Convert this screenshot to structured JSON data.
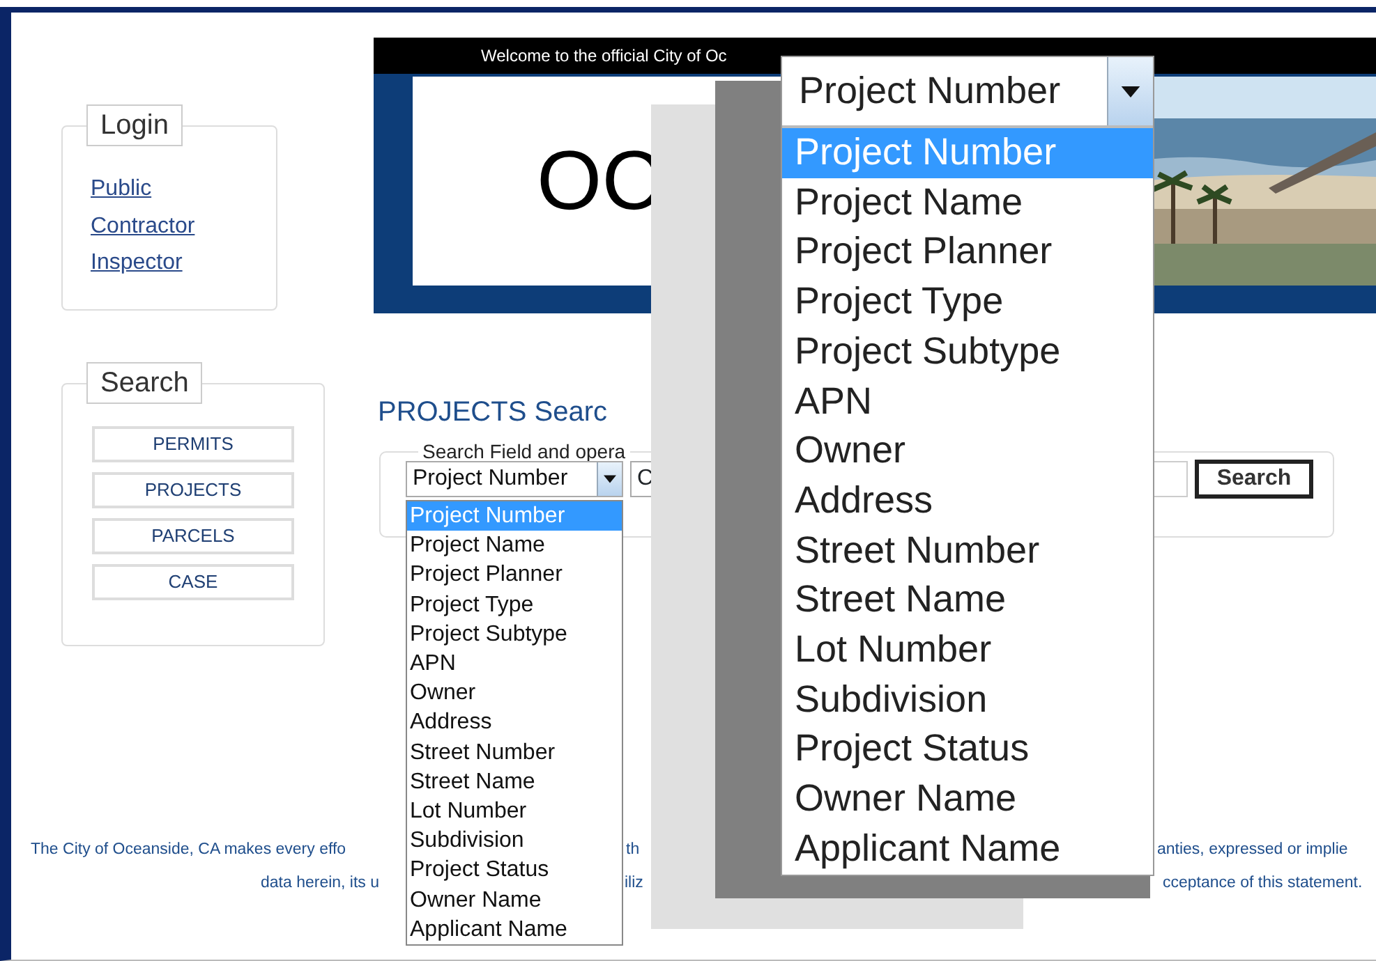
{
  "login": {
    "title": "Login",
    "links": [
      "Public",
      "Contractor",
      "Inspector"
    ]
  },
  "search_menu": {
    "title": "Search",
    "buttons": [
      "PERMITS",
      "PROJECTS",
      "PARCELS",
      "CASE"
    ]
  },
  "banner": {
    "welcome": "Welcome to the official City of Oc",
    "logo_text": "OC"
  },
  "projects_search": {
    "heading": "PROJECTS Searc",
    "legend": "Search Field and opera",
    "field_select": {
      "value": "Project Number",
      "expanded": true
    },
    "operator_select": {
      "value": "C"
    },
    "search_button": "Search",
    "options": [
      {
        "label": "Project Number",
        "selected": true
      },
      {
        "label": "Project Name",
        "selected": false
      },
      {
        "label": "Project Planner",
        "selected": false
      },
      {
        "label": "Project Type",
        "selected": false
      },
      {
        "label": "Project Subtype",
        "selected": false
      },
      {
        "label": "APN",
        "selected": false
      },
      {
        "label": "Owner",
        "selected": false
      },
      {
        "label": "Address",
        "selected": false
      },
      {
        "label": "Street Number",
        "selected": false
      },
      {
        "label": "Street Name",
        "selected": false
      },
      {
        "label": "Lot Number",
        "selected": false
      },
      {
        "label": "Subdivision",
        "selected": false
      },
      {
        "label": "Project Status",
        "selected": false
      },
      {
        "label": "Owner Name",
        "selected": false
      },
      {
        "label": "Applicant Name",
        "selected": false
      }
    ]
  },
  "zoom_callout": {
    "select_value": "Project Number",
    "expanded": true,
    "options": [
      {
        "label": "Project Number",
        "selected": true
      },
      {
        "label": "Project Name",
        "selected": false
      },
      {
        "label": "Project Planner",
        "selected": false
      },
      {
        "label": "Project Type",
        "selected": false
      },
      {
        "label": "Project Subtype",
        "selected": false
      },
      {
        "label": "APN",
        "selected": false
      },
      {
        "label": "Owner",
        "selected": false
      },
      {
        "label": "Address",
        "selected": false
      },
      {
        "label": "Street Number",
        "selected": false
      },
      {
        "label": "Street Name",
        "selected": false
      },
      {
        "label": "Lot Number",
        "selected": false
      },
      {
        "label": "Subdivision",
        "selected": false
      },
      {
        "label": "Project Status",
        "selected": false
      },
      {
        "label": "Owner Name",
        "selected": false
      },
      {
        "label": "Applicant Name",
        "selected": false
      }
    ]
  },
  "footer": {
    "line_1": [
      "The City of Oceanside, CA makes every effo",
      "th",
      "anties, expressed or implie"
    ],
    "line_2": [
      "data herein, its u",
      "iliz",
      "cceptance of this statement."
    ]
  }
}
